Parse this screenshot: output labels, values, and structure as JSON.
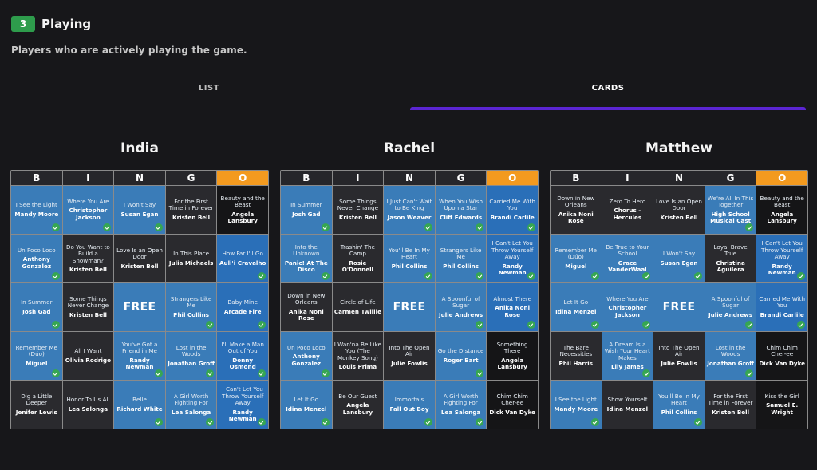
{
  "section": {
    "count": "3",
    "title": "Playing",
    "description": "Players who are actively playing the game."
  },
  "tabs": [
    {
      "label": "LIST",
      "active": false
    },
    {
      "label": "CARDS",
      "active": true
    }
  ],
  "colors": {
    "accent_tab": "#5b25d3",
    "badge": "#2e9c4c",
    "o_header": "#f39a1f",
    "marked_cell": "#3a7cb8",
    "unmarked_cell": "#2a2a2e",
    "check": "#36a652"
  },
  "bingo_headers": [
    "B",
    "I",
    "N",
    "G",
    "O"
  ],
  "free_label": "FREE",
  "cards": [
    {
      "player": "India",
      "rows": [
        [
          {
            "song": "I See the Light",
            "artist": "Mandy Moore",
            "marked": true
          },
          {
            "song": "Where You Are",
            "artist": "Christopher Jackson",
            "marked": true
          },
          {
            "song": "I Won't Say",
            "artist": "Susan Egan",
            "marked": true
          },
          {
            "song": "For the First Time in Forever",
            "artist": "Kristen Bell",
            "marked": false
          },
          {
            "song": "Beauty and the Beast",
            "artist": "Angela Lansbury",
            "marked": false
          }
        ],
        [
          {
            "song": "Un Poco Loco",
            "artist": "Anthony Gonzalez",
            "marked": true
          },
          {
            "song": "Do You Want to Build a Snowman?",
            "artist": "Kristen Bell",
            "marked": false
          },
          {
            "song": "Love Is an Open Door",
            "artist": "Kristen Bell",
            "marked": false
          },
          {
            "song": "In This Place",
            "artist": "Julia Michaels",
            "marked": false
          },
          {
            "song": "How Far I'll Go",
            "artist": "Auli'i Cravalho",
            "marked": true
          }
        ],
        [
          {
            "song": "In Summer",
            "artist": "Josh Gad",
            "marked": true
          },
          {
            "song": "Some Things Never Change",
            "artist": "Kristen Bell",
            "marked": false
          },
          {
            "free": true
          },
          {
            "song": "Strangers Like Me",
            "artist": "Phil Collins",
            "marked": true
          },
          {
            "song": "Baby Mine",
            "artist": "Arcade Fire",
            "marked": true
          }
        ],
        [
          {
            "song": "Remember Me (Dúo)",
            "artist": "Miguel",
            "marked": true
          },
          {
            "song": "All I Want",
            "artist": "Olivia Rodrigo",
            "marked": false
          },
          {
            "song": "You've Got a Friend in Me",
            "artist": "Randy Newman",
            "marked": true
          },
          {
            "song": "Lost in the Woods",
            "artist": "Jonathan Groff",
            "marked": true
          },
          {
            "song": "I'll Make a Man Out of You",
            "artist": "Donny Osmond",
            "marked": true
          }
        ],
        [
          {
            "song": "Dig a Little Deeper",
            "artist": "Jenifer Lewis",
            "marked": false
          },
          {
            "song": "Honor To Us All",
            "artist": "Lea Salonga",
            "marked": false
          },
          {
            "song": "Belle",
            "artist": "Richard White",
            "marked": true
          },
          {
            "song": "A Girl Worth Fighting For",
            "artist": "Lea Salonga",
            "marked": true
          },
          {
            "song": "I Can't Let You Throw Yourself Away",
            "artist": "Randy Newman",
            "marked": true
          }
        ]
      ]
    },
    {
      "player": "Rachel",
      "rows": [
        [
          {
            "song": "In Summer",
            "artist": "Josh Gad",
            "marked": true
          },
          {
            "song": "Some Things Never Change",
            "artist": "Kristen Bell",
            "marked": false
          },
          {
            "song": "I Just Can't Wait to Be King",
            "artist": "Jason Weaver",
            "marked": true
          },
          {
            "song": "When You Wish Upon a Star",
            "artist": "Cliff Edwards",
            "marked": true
          },
          {
            "song": "Carried Me With You",
            "artist": "Brandi Carlile",
            "marked": true
          }
        ],
        [
          {
            "song": "Into the Unknown",
            "artist": "Panic! At The Disco",
            "marked": true
          },
          {
            "song": "Trashin' The Camp",
            "artist": "Rosie O'Donnell",
            "marked": false
          },
          {
            "song": "You'll Be In My Heart",
            "artist": "Phil Collins",
            "marked": true
          },
          {
            "song": "Strangers Like Me",
            "artist": "Phil Collins",
            "marked": true
          },
          {
            "song": "I Can't Let You Throw Yourself Away",
            "artist": "Randy Newman",
            "marked": true
          }
        ],
        [
          {
            "song": "Down in New Orleans",
            "artist": "Anika Noni Rose",
            "marked": false
          },
          {
            "song": "Circle of Life",
            "artist": "Carmen Twillie",
            "marked": false
          },
          {
            "free": true
          },
          {
            "song": "A Spoonful of Sugar",
            "artist": "Julie Andrews",
            "marked": true
          },
          {
            "song": "Almost There",
            "artist": "Anika Noni Rose",
            "marked": true
          }
        ],
        [
          {
            "song": "Un Poco Loco",
            "artist": "Anthony Gonzalez",
            "marked": true
          },
          {
            "song": "I Wan'na Be Like You (The Monkey Song)",
            "artist": "Louis Prima",
            "marked": false
          },
          {
            "song": "Into The Open Air",
            "artist": "Julie Fowlis",
            "marked": false
          },
          {
            "song": "Go the Distance",
            "artist": "Roger Bart",
            "marked": true
          },
          {
            "song": "Something There",
            "artist": "Angela Lansbury",
            "marked": false
          }
        ],
        [
          {
            "song": "Let It Go",
            "artist": "Idina Menzel",
            "marked": true
          },
          {
            "song": "Be Our Guest",
            "artist": "Angela Lansbury",
            "marked": false
          },
          {
            "song": "Immortals",
            "artist": "Fall Out Boy",
            "marked": true
          },
          {
            "song": "A Girl Worth Fighting For",
            "artist": "Lea Salonga",
            "marked": true
          },
          {
            "song": "Chim Chim Cher-ee",
            "artist": "Dick Van Dyke",
            "marked": false
          }
        ]
      ]
    },
    {
      "player": "Matthew",
      "rows": [
        [
          {
            "song": "Down in New Orleans",
            "artist": "Anika Noni Rose",
            "marked": false
          },
          {
            "song": "Zero To Hero",
            "artist": "Chorus - Hercules",
            "marked": false
          },
          {
            "song": "Love Is an Open Door",
            "artist": "Kristen Bell",
            "marked": false
          },
          {
            "song": "We're All In This Together",
            "artist": "High School Musical Cast",
            "marked": true
          },
          {
            "song": "Beauty and the Beast",
            "artist": "Angela Lansbury",
            "marked": false
          }
        ],
        [
          {
            "song": "Remember Me (Dúo)",
            "artist": "Miguel",
            "marked": true
          },
          {
            "song": "Be True to Your School",
            "artist": "Grace VanderWaal",
            "marked": true
          },
          {
            "song": "I Won't Say",
            "artist": "Susan Egan",
            "marked": true
          },
          {
            "song": "Loyal Brave True",
            "artist": "Christina Aguilera",
            "marked": false
          },
          {
            "song": "I Can't Let You Throw Yourself Away",
            "artist": "Randy Newman",
            "marked": true
          }
        ],
        [
          {
            "song": "Let It Go",
            "artist": "Idina Menzel",
            "marked": true
          },
          {
            "song": "Where You Are",
            "artist": "Christopher Jackson",
            "marked": true
          },
          {
            "free": true
          },
          {
            "song": "A Spoonful of Sugar",
            "artist": "Julie Andrews",
            "marked": true
          },
          {
            "song": "Carried Me With You",
            "artist": "Brandi Carlile",
            "marked": true
          }
        ],
        [
          {
            "song": "The Bare Necessities",
            "artist": "Phil Harris",
            "marked": false
          },
          {
            "song": "A Dream Is a Wish Your Heart Makes",
            "artist": "Lily James",
            "marked": true
          },
          {
            "song": "Into The Open Air",
            "artist": "Julie Fowlis",
            "marked": false
          },
          {
            "song": "Lost in the Woods",
            "artist": "Jonathan Groff",
            "marked": true
          },
          {
            "song": "Chim Chim Cher-ee",
            "artist": "Dick Van Dyke",
            "marked": false
          }
        ],
        [
          {
            "song": "I See the Light",
            "artist": "Mandy Moore",
            "marked": true
          },
          {
            "song": "Show Yourself",
            "artist": "Idina Menzel",
            "marked": false
          },
          {
            "song": "You'll Be In My Heart",
            "artist": "Phil Collins",
            "marked": true
          },
          {
            "song": "For the First Time in Forever",
            "artist": "Kristen Bell",
            "marked": false
          },
          {
            "song": "Kiss the Girl",
            "artist": "Samuel E. Wright",
            "marked": false
          }
        ]
      ]
    }
  ]
}
